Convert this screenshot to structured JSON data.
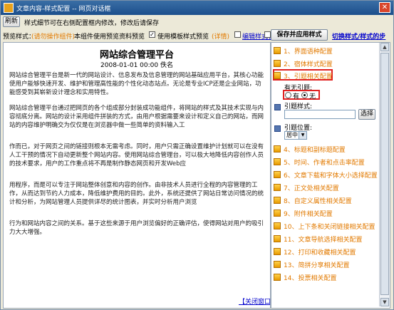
{
  "window": {
    "title": "文章内容-样式配置 -- 网页对话框",
    "close_symbol": "✕"
  },
  "toolbar": {
    "refresh_label": "刷新",
    "hint": "样式细节可在右侧配置框内修改，修改后请保存"
  },
  "options": {
    "preview_label": "预览样式：",
    "component_note": "(请勿操作组件)",
    "component_hint": "本组件使用预览资料预览",
    "template_label": "使用模板样式预览",
    "template_detail": "(详情)",
    "edit_style_link": "编辑样式表",
    "template_checked": true
  },
  "preview": {
    "title": "网站综合管理平台",
    "meta": "2008-01-01 00:00 佚名",
    "paragraphs": [
      "网站综合管理平台是新一代的网站设计、信息发布及信息管理的网站基础应用平台，其核心功能使用户能够快速开发、维护和管理高性能的个性化动态站点。无论是专业ICP还是企业网站，功能感受到其崭新设计理念和实用特性。",
      "网站综合管理平台通过把网页的各个组成部分封装成功能组件，将网站的样式及其技术实现与内容彻底分离。网站的设计采用组件拼装的方式，由用户根据需要来设计和定义自己的网站，而网站的内容维护明确交为仅仅是在浏览器中做一些简单的资料输入工",
      "作而已，对于网页之间的链接则根本无需考虑。同时，用户只需正确设置维护计划就可以在没有人工干预的情况下自动更新整个网站内容。使用网站综合管理台，可以极大地降低内容创作人员的技术要求，用户的工作重点将不再是制作静态网页和开发Web应",
      "用程序，而是可以专注于网站整体创意和内容的创作。由非技术人员进行全程的内容管理的工作，从而达到节约人力成本，降低维护费用的目的。此外，系统还提供了网站日常访问情况的统计和分析，为网站管理人员提供详尽的统计图表，并实时分析用户浏览",
      "行为和网站内容之间的关系。基于这些来源于用户浏览偏好的正确评估，使得网站对用户的吸引力大大增强。"
    ],
    "close_link": "【关闭窗口】"
  },
  "config": {
    "apply_label": "保存并应用样式",
    "switch_link": "切换样式/样式的步",
    "items_top": [
      "1、界面语种配置",
      "2、宿体样式配置",
      "3、引题相关配置"
    ],
    "lead": {
      "has_label": "有无引题:",
      "yes_label": "有",
      "no_label": "无",
      "selected": "无",
      "style_label": "引题样式:",
      "style_value": "",
      "select_button": "选择",
      "position_label": "引题位置:",
      "position_value": "居中"
    },
    "items_bottom": [
      "4、标题和副标题配置",
      "5、时间、作者和点击率配置",
      "6、文章下载和字体大小选择配置",
      "7、正文处相关配置",
      "8、自定义属性相关配置",
      "9、附件相关配置",
      "10、上下条和关闭链接相关配置",
      "11、文章导航选择相关配置",
      "12、打印和收藏相关配置",
      "13、简拼分享相关配置",
      "14、投票相关配置"
    ]
  },
  "colors": {
    "accent_orange": "#e27a00",
    "highlight_red": "#e02020",
    "link_blue": "#0000cc"
  }
}
